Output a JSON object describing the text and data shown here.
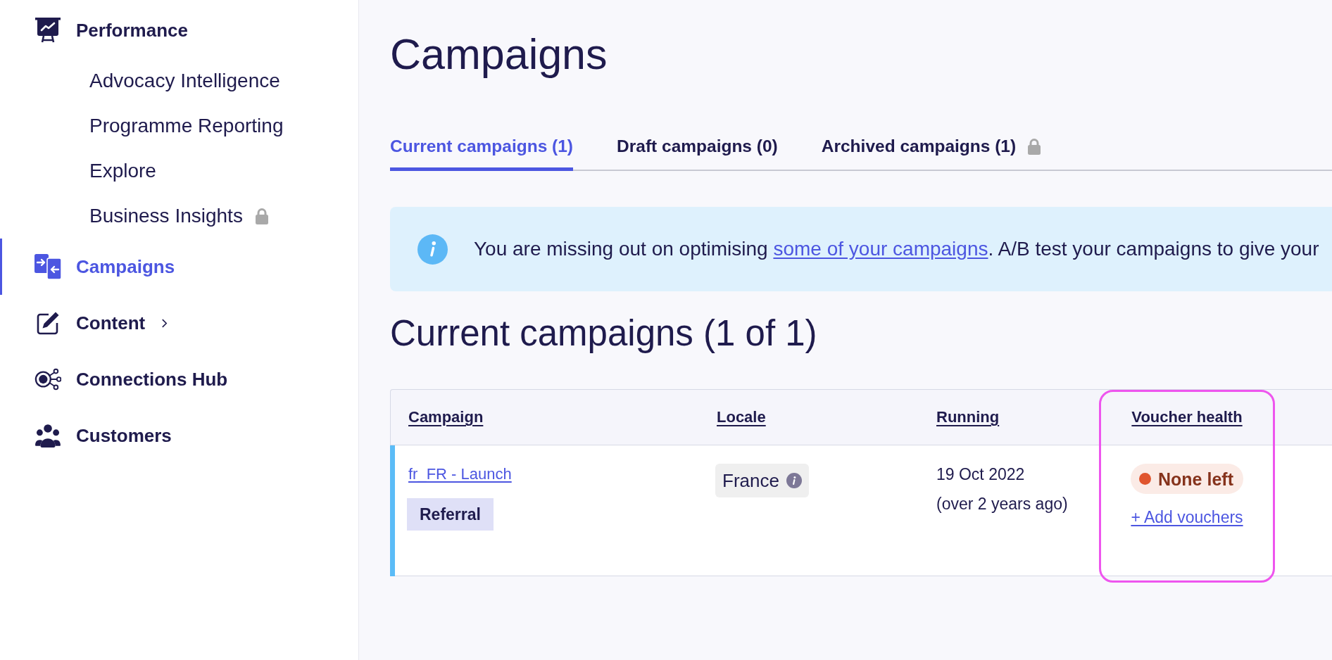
{
  "sidebar": {
    "items": [
      {
        "kind": "group",
        "label": "Performance",
        "selected": false,
        "children": [
          {
            "label": "Advocacy Intelligence",
            "selected": false,
            "locked": false
          },
          {
            "label": "Programme Reporting",
            "selected": false,
            "locked": false
          },
          {
            "label": "Explore",
            "selected": false,
            "locked": false
          },
          {
            "label": "Business Insights",
            "selected": false,
            "locked": true
          }
        ]
      },
      {
        "kind": "link",
        "label": "Campaigns",
        "selected": true
      },
      {
        "kind": "menu",
        "label": "Content",
        "selected": false
      },
      {
        "kind": "link",
        "label": "Connections Hub",
        "selected": false
      },
      {
        "kind": "link",
        "label": "Customers",
        "selected": false
      }
    ]
  },
  "page": {
    "title": "Campaigns"
  },
  "tabs": [
    {
      "label": "Current campaigns (1)",
      "selected": true,
      "locked": false
    },
    {
      "label": "Draft campaigns (0)",
      "selected": false,
      "locked": false
    },
    {
      "label": "Archived campaigns (1)",
      "selected": false,
      "locked": true
    }
  ],
  "banner": {
    "text_before": "You are missing out on optimising ",
    "link": "some of your campaigns",
    "text_after": ". A/B test your campaigns to give your"
  },
  "section": {
    "heading": "Current campaigns (1 of 1)"
  },
  "table": {
    "columns": [
      {
        "label": "Campaign"
      },
      {
        "label": "Locale"
      },
      {
        "label": "Running"
      },
      {
        "label": "Voucher health",
        "highlight": {
          "kind": "outline"
        }
      }
    ],
    "rows": [
      {
        "color": "#5bbcf7",
        "campaign": {
          "name": "fr_FR - Launch",
          "tag": "Referral"
        },
        "locale": "France",
        "running": {
          "date": "19 Oct 2022",
          "relative": "(over 2 years ago)"
        },
        "voucher_health": {
          "status": "None left",
          "color": "#e0552e",
          "action": "+ Add vouchers"
        }
      }
    ]
  }
}
